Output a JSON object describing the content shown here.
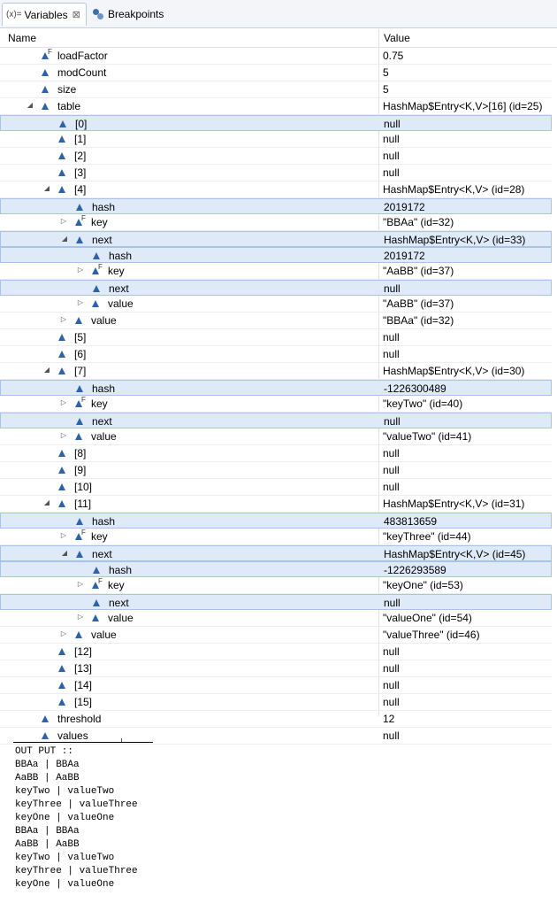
{
  "tabs": {
    "variables_icon": "(x)=",
    "variables": "Variables",
    "breakpoints": "Breakpoints"
  },
  "columns": {
    "name": "Name",
    "value": "Value"
  },
  "rows": [
    {
      "name": "loadFactor",
      "value": "0.75",
      "indent": 0,
      "twisty": "",
      "final": true,
      "sel": false
    },
    {
      "name": "modCount",
      "value": "5",
      "indent": 0,
      "twisty": "",
      "final": false,
      "sel": false
    },
    {
      "name": "size",
      "value": "5",
      "indent": 0,
      "twisty": "",
      "final": false,
      "sel": false
    },
    {
      "name": "table",
      "value": "HashMap$Entry<K,V>[16]  (id=25)",
      "indent": 0,
      "twisty": "open",
      "final": false,
      "sel": false
    },
    {
      "name": "[0]",
      "value": "null",
      "indent": 1,
      "twisty": "",
      "final": false,
      "sel": true
    },
    {
      "name": "[1]",
      "value": "null",
      "indent": 1,
      "twisty": "",
      "final": false,
      "sel": false
    },
    {
      "name": "[2]",
      "value": "null",
      "indent": 1,
      "twisty": "",
      "final": false,
      "sel": false
    },
    {
      "name": "[3]",
      "value": "null",
      "indent": 1,
      "twisty": "",
      "final": false,
      "sel": false
    },
    {
      "name": "[4]",
      "value": "HashMap$Entry<K,V>  (id=28)",
      "indent": 1,
      "twisty": "open",
      "final": false,
      "sel": false
    },
    {
      "name": "hash",
      "value": "2019172",
      "indent": 2,
      "twisty": "",
      "final": false,
      "sel": true
    },
    {
      "name": "key",
      "value": "\"BBAa\" (id=32)",
      "indent": 2,
      "twisty": "closed",
      "final": true,
      "sel": false
    },
    {
      "name": "next",
      "value": "HashMap$Entry<K,V>  (id=33)",
      "indent": 2,
      "twisty": "open",
      "final": false,
      "sel": true
    },
    {
      "name": "hash",
      "value": "2019172",
      "indent": 3,
      "twisty": "",
      "final": false,
      "sel": true
    },
    {
      "name": "key",
      "value": "\"AaBB\" (id=37)",
      "indent": 3,
      "twisty": "closed",
      "final": true,
      "sel": false
    },
    {
      "name": "next",
      "value": "null",
      "indent": 3,
      "twisty": "",
      "final": false,
      "sel": true
    },
    {
      "name": "value",
      "value": "\"AaBB\" (id=37)",
      "indent": 3,
      "twisty": "closed",
      "final": false,
      "sel": false
    },
    {
      "name": "value",
      "value": "\"BBAa\" (id=32)",
      "indent": 2,
      "twisty": "closed",
      "final": false,
      "sel": false
    },
    {
      "name": "[5]",
      "value": "null",
      "indent": 1,
      "twisty": "",
      "final": false,
      "sel": false
    },
    {
      "name": "[6]",
      "value": "null",
      "indent": 1,
      "twisty": "",
      "final": false,
      "sel": false
    },
    {
      "name": "[7]",
      "value": "HashMap$Entry<K,V>  (id=30)",
      "indent": 1,
      "twisty": "open",
      "final": false,
      "sel": false
    },
    {
      "name": "hash",
      "value": "-1226300489",
      "indent": 2,
      "twisty": "",
      "final": false,
      "sel": true
    },
    {
      "name": "key",
      "value": "\"keyTwo\" (id=40)",
      "indent": 2,
      "twisty": "closed",
      "final": true,
      "sel": false
    },
    {
      "name": "next",
      "value": "null",
      "indent": 2,
      "twisty": "",
      "final": false,
      "sel": true
    },
    {
      "name": "value",
      "value": "\"valueTwo\" (id=41)",
      "indent": 2,
      "twisty": "closed",
      "final": false,
      "sel": false
    },
    {
      "name": "[8]",
      "value": "null",
      "indent": 1,
      "twisty": "",
      "final": false,
      "sel": false
    },
    {
      "name": "[9]",
      "value": "null",
      "indent": 1,
      "twisty": "",
      "final": false,
      "sel": false
    },
    {
      "name": "[10]",
      "value": "null",
      "indent": 1,
      "twisty": "",
      "final": false,
      "sel": false
    },
    {
      "name": "[11]",
      "value": "HashMap$Entry<K,V>  (id=31)",
      "indent": 1,
      "twisty": "open",
      "final": false,
      "sel": false
    },
    {
      "name": "hash",
      "value": "483813659",
      "indent": 2,
      "twisty": "",
      "final": false,
      "sel": true
    },
    {
      "name": "key",
      "value": "\"keyThree\" (id=44)",
      "indent": 2,
      "twisty": "closed",
      "final": true,
      "sel": false
    },
    {
      "name": "next",
      "value": "HashMap$Entry<K,V>  (id=45)",
      "indent": 2,
      "twisty": "open",
      "final": false,
      "sel": true
    },
    {
      "name": "hash",
      "value": "-1226293589",
      "indent": 3,
      "twisty": "",
      "final": false,
      "sel": true
    },
    {
      "name": "key",
      "value": "\"keyOne\" (id=53)",
      "indent": 3,
      "twisty": "closed",
      "final": true,
      "sel": false
    },
    {
      "name": "next",
      "value": "null",
      "indent": 3,
      "twisty": "",
      "final": false,
      "sel": true
    },
    {
      "name": "value",
      "value": "\"valueOne\" (id=54)",
      "indent": 3,
      "twisty": "closed",
      "final": false,
      "sel": false
    },
    {
      "name": "value",
      "value": "\"valueThree\" (id=46)",
      "indent": 2,
      "twisty": "closed",
      "final": false,
      "sel": false
    },
    {
      "name": "[12]",
      "value": "null",
      "indent": 1,
      "twisty": "",
      "final": false,
      "sel": false
    },
    {
      "name": "[13]",
      "value": "null",
      "indent": 1,
      "twisty": "",
      "final": false,
      "sel": false
    },
    {
      "name": "[14]",
      "value": "null",
      "indent": 1,
      "twisty": "",
      "final": false,
      "sel": false
    },
    {
      "name": "[15]",
      "value": "null",
      "indent": 1,
      "twisty": "",
      "final": false,
      "sel": false
    },
    {
      "name": "threshold",
      "value": "12",
      "indent": 0,
      "twisty": "",
      "final": false,
      "sel": false
    },
    {
      "name": "values",
      "value": "null",
      "indent": 0,
      "twisty": "",
      "final": false,
      "sel": false
    }
  ],
  "output": {
    "title": "OUT PUT ::",
    "lines": [
      "BBAa | BBAa",
      "AaBB | AaBB",
      "keyTwo | valueTwo",
      "keyThree | valueThree",
      "keyOne | valueOne",
      "BBAa | BBAa",
      "AaBB | AaBB",
      "keyTwo | valueTwo",
      "keyThree | valueThree",
      "keyOne | valueOne"
    ]
  },
  "colors": {
    "selection": "#dfeaf9",
    "variable_icon": "#2d63a8"
  }
}
